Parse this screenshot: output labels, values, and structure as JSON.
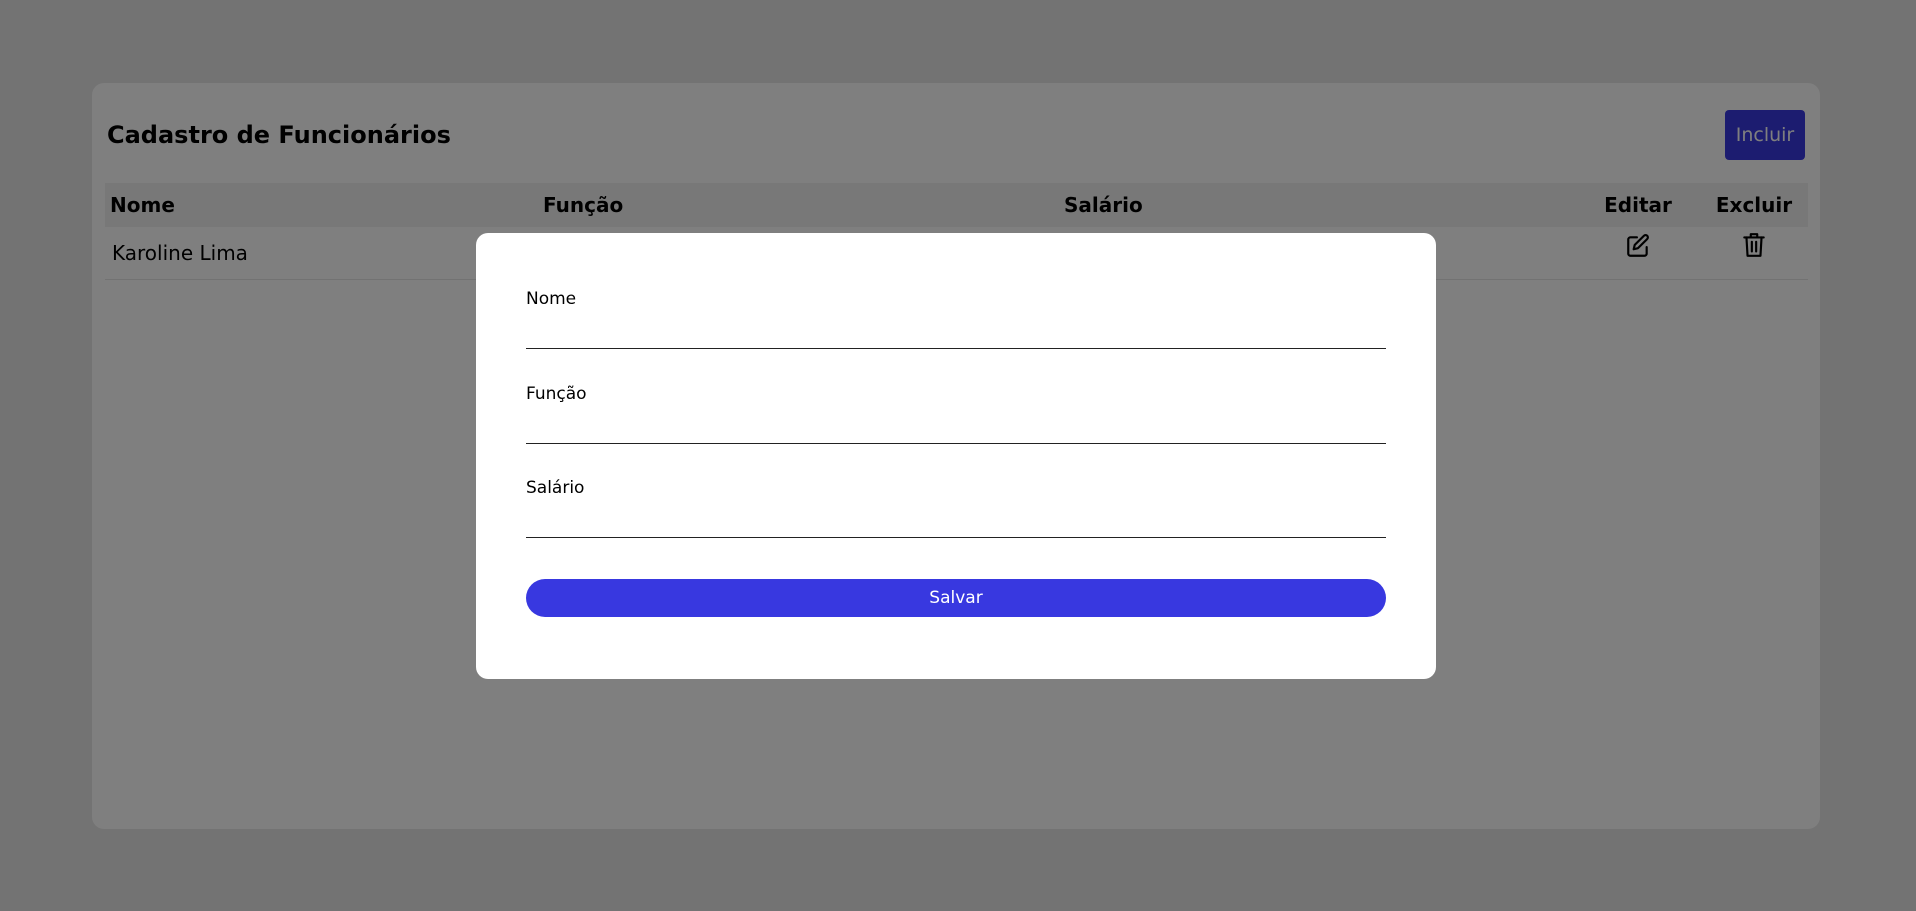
{
  "page": {
    "title": "Cadastro de Funcionários",
    "add_button_label": "Incluir"
  },
  "table": {
    "columns": [
      "Nome",
      "Função",
      "Salário",
      "Editar",
      "Excluir"
    ],
    "rows": [
      {
        "nome": "Karoline Lima",
        "funcao": "",
        "salario": ""
      }
    ]
  },
  "modal": {
    "fields": [
      {
        "label": "Nome",
        "value": ""
      },
      {
        "label": "Função",
        "value": ""
      },
      {
        "label": "Salário",
        "value": ""
      }
    ],
    "save_label": "Salvar"
  },
  "icons": {
    "edit": "edit-icon",
    "delete": "trash-icon"
  },
  "colors": {
    "accent": "#3838e0",
    "overlay": "rgba(0,0,0,0.5)",
    "background": "#e6e6e6"
  }
}
